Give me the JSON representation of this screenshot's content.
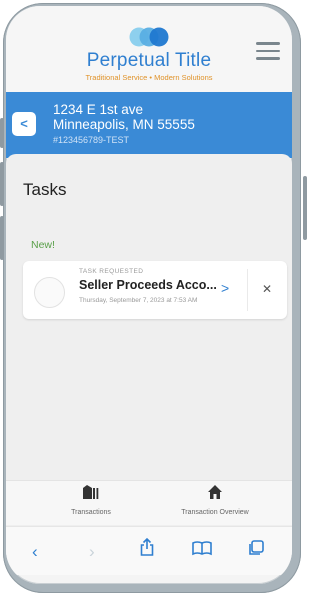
{
  "header": {
    "brand_name": "Perpetual Title",
    "tagline": "Traditional Service • Modern Solutions",
    "colors": {
      "brand_blue": "#2f7fd0",
      "brand_orange": "#e0932a"
    }
  },
  "address": {
    "back_icon": "<",
    "line1": "1234 E 1st ave",
    "line2": "Minneapolis, MN 55555",
    "file_id": "#123456789-TEST"
  },
  "tasks": {
    "title": "Tasks",
    "section_label": "New!",
    "items": [
      {
        "kicker": "TASK REQUESTED",
        "name": "Seller Proceeds Acco...",
        "date": "Thursday, September 7, 2023 at 7:53 AM",
        "open_icon": ">",
        "close_icon": "✕"
      }
    ]
  },
  "tabbar": {
    "items": [
      {
        "label": "Transactions",
        "icon": "document-stack-icon"
      },
      {
        "label": "Transaction Overview",
        "icon": "home-icon"
      }
    ]
  },
  "safari": {
    "back": "‹",
    "forward": "›"
  }
}
